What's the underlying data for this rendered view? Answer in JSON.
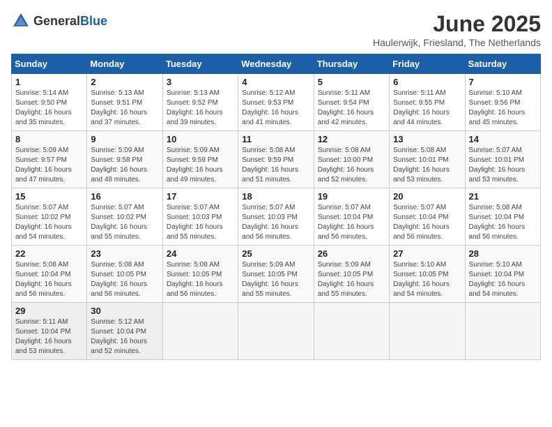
{
  "header": {
    "logo_general": "General",
    "logo_blue": "Blue",
    "month_title": "June 2025",
    "location": "Haulerwijk, Friesland, The Netherlands"
  },
  "calendar": {
    "days_of_week": [
      "Sunday",
      "Monday",
      "Tuesday",
      "Wednesday",
      "Thursday",
      "Friday",
      "Saturday"
    ],
    "weeks": [
      [
        {
          "day": "",
          "info": ""
        },
        {
          "day": "2",
          "info": "Sunrise: 5:13 AM\nSunset: 9:51 PM\nDaylight: 16 hours\nand 37 minutes."
        },
        {
          "day": "3",
          "info": "Sunrise: 5:13 AM\nSunset: 9:52 PM\nDaylight: 16 hours\nand 39 minutes."
        },
        {
          "day": "4",
          "info": "Sunrise: 5:12 AM\nSunset: 9:53 PM\nDaylight: 16 hours\nand 41 minutes."
        },
        {
          "day": "5",
          "info": "Sunrise: 5:11 AM\nSunset: 9:54 PM\nDaylight: 16 hours\nand 42 minutes."
        },
        {
          "day": "6",
          "info": "Sunrise: 5:11 AM\nSunset: 9:55 PM\nDaylight: 16 hours\nand 44 minutes."
        },
        {
          "day": "7",
          "info": "Sunrise: 5:10 AM\nSunset: 9:56 PM\nDaylight: 16 hours\nand 45 minutes."
        }
      ],
      [
        {
          "day": "8",
          "info": "Sunrise: 5:09 AM\nSunset: 9:57 PM\nDaylight: 16 hours\nand 47 minutes."
        },
        {
          "day": "9",
          "info": "Sunrise: 5:09 AM\nSunset: 9:58 PM\nDaylight: 16 hours\nand 48 minutes."
        },
        {
          "day": "10",
          "info": "Sunrise: 5:09 AM\nSunset: 9:59 PM\nDaylight: 16 hours\nand 49 minutes."
        },
        {
          "day": "11",
          "info": "Sunrise: 5:08 AM\nSunset: 9:59 PM\nDaylight: 16 hours\nand 51 minutes."
        },
        {
          "day": "12",
          "info": "Sunrise: 5:08 AM\nSunset: 10:00 PM\nDaylight: 16 hours\nand 52 minutes."
        },
        {
          "day": "13",
          "info": "Sunrise: 5:08 AM\nSunset: 10:01 PM\nDaylight: 16 hours\nand 53 minutes."
        },
        {
          "day": "14",
          "info": "Sunrise: 5:07 AM\nSunset: 10:01 PM\nDaylight: 16 hours\nand 53 minutes."
        }
      ],
      [
        {
          "day": "15",
          "info": "Sunrise: 5:07 AM\nSunset: 10:02 PM\nDaylight: 16 hours\nand 54 minutes."
        },
        {
          "day": "16",
          "info": "Sunrise: 5:07 AM\nSunset: 10:02 PM\nDaylight: 16 hours\nand 55 minutes."
        },
        {
          "day": "17",
          "info": "Sunrise: 5:07 AM\nSunset: 10:03 PM\nDaylight: 16 hours\nand 55 minutes."
        },
        {
          "day": "18",
          "info": "Sunrise: 5:07 AM\nSunset: 10:03 PM\nDaylight: 16 hours\nand 56 minutes."
        },
        {
          "day": "19",
          "info": "Sunrise: 5:07 AM\nSunset: 10:04 PM\nDaylight: 16 hours\nand 56 minutes."
        },
        {
          "day": "20",
          "info": "Sunrise: 5:07 AM\nSunset: 10:04 PM\nDaylight: 16 hours\nand 56 minutes."
        },
        {
          "day": "21",
          "info": "Sunrise: 5:08 AM\nSunset: 10:04 PM\nDaylight: 16 hours\nand 56 minutes."
        }
      ],
      [
        {
          "day": "22",
          "info": "Sunrise: 5:08 AM\nSunset: 10:04 PM\nDaylight: 16 hours\nand 56 minutes."
        },
        {
          "day": "23",
          "info": "Sunrise: 5:08 AM\nSunset: 10:05 PM\nDaylight: 16 hours\nand 56 minutes."
        },
        {
          "day": "24",
          "info": "Sunrise: 5:08 AM\nSunset: 10:05 PM\nDaylight: 16 hours\nand 56 minutes."
        },
        {
          "day": "25",
          "info": "Sunrise: 5:09 AM\nSunset: 10:05 PM\nDaylight: 16 hours\nand 55 minutes."
        },
        {
          "day": "26",
          "info": "Sunrise: 5:09 AM\nSunset: 10:05 PM\nDaylight: 16 hours\nand 55 minutes."
        },
        {
          "day": "27",
          "info": "Sunrise: 5:10 AM\nSunset: 10:05 PM\nDaylight: 16 hours\nand 54 minutes."
        },
        {
          "day": "28",
          "info": "Sunrise: 5:10 AM\nSunset: 10:04 PM\nDaylight: 16 hours\nand 54 minutes."
        }
      ],
      [
        {
          "day": "29",
          "info": "Sunrise: 5:11 AM\nSunset: 10:04 PM\nDaylight: 16 hours\nand 53 minutes."
        },
        {
          "day": "30",
          "info": "Sunrise: 5:12 AM\nSunset: 10:04 PM\nDaylight: 16 hours\nand 52 minutes."
        },
        {
          "day": "",
          "info": ""
        },
        {
          "day": "",
          "info": ""
        },
        {
          "day": "",
          "info": ""
        },
        {
          "day": "",
          "info": ""
        },
        {
          "day": "",
          "info": ""
        }
      ]
    ],
    "week1_sunday": {
      "day": "1",
      "info": "Sunrise: 5:14 AM\nSunset: 9:50 PM\nDaylight: 16 hours\nand 35 minutes."
    }
  }
}
